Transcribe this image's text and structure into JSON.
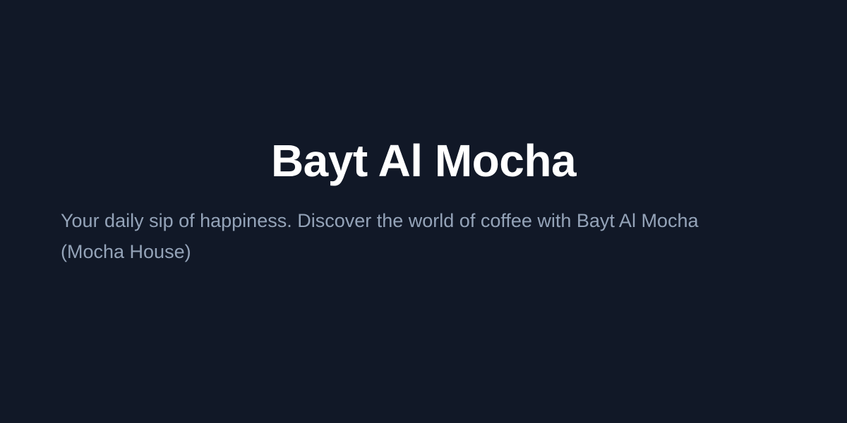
{
  "page": {
    "title": "Bayt Al Mocha",
    "description": "Your daily sip of happiness. Discover the world of coffee with Bayt Al Mocha (Mocha House)"
  },
  "colors": {
    "background": "#111827",
    "title": "#ffffff",
    "description": "#94a3b8"
  }
}
